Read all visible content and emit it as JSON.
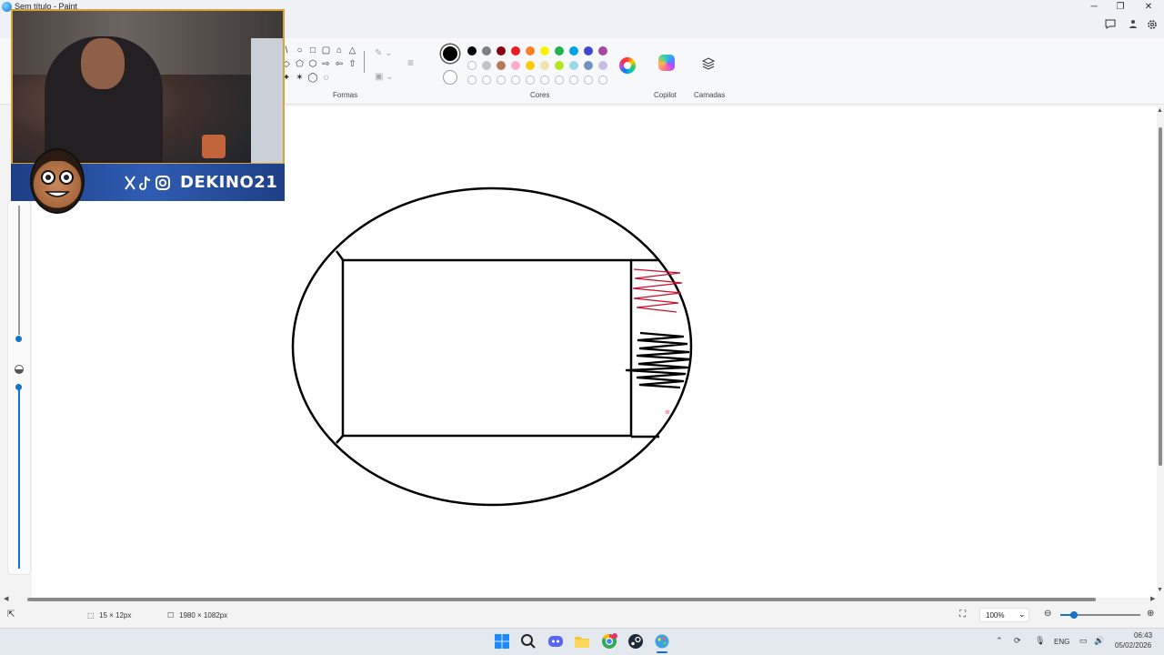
{
  "window": {
    "title": "Sem título - Paint",
    "minimize_glyph": "─",
    "maximize_glyph": "❐",
    "close_glyph": "✕"
  },
  "ribbon": {
    "groups": {
      "shapes_label": "Formas",
      "colors_label": "Cores",
      "copilot_label": "Copilot",
      "layers_label": "Camadas"
    },
    "shape_glyphs": [
      "\\",
      "○",
      "□",
      "▢",
      "⌂",
      "△",
      "◇",
      "⬠",
      "⬡",
      "⇨",
      "⇦",
      "⇧",
      "✦",
      "✶",
      "◯",
      "◌"
    ],
    "colors_row1": [
      "#000000",
      "#7f7f7f",
      "#880015",
      "#ed1c24",
      "#ff7f27",
      "#fff200",
      "#22b14c",
      "#00a2e8",
      "#3f48cc",
      "#a349a4"
    ],
    "colors_row2": [
      "#ffffff",
      "#c3c3c3",
      "#b97a57",
      "#ffaec9",
      "#ffc90e",
      "#efe4b0",
      "#b5e61d",
      "#99d9ea",
      "#7092be",
      "#c8bfe7"
    ],
    "primary_color": "#000000",
    "secondary_color": "#ffffff"
  },
  "webcam": {
    "banner_text": "DEKINO21",
    "social_icons": [
      "x-logo",
      "tiktok-logo",
      "instagram-logo"
    ]
  },
  "statusbar": {
    "selection_size": "15 × 12px",
    "canvas_size": "1980 × 1082px",
    "zoom": "100%"
  },
  "taskbar": {
    "language": "ENG",
    "time": "06:43",
    "date": "05/02/2026",
    "pinned_apps": [
      "windows-start",
      "search",
      "discord",
      "file-explorer",
      "chrome",
      "steam",
      "paint"
    ]
  }
}
